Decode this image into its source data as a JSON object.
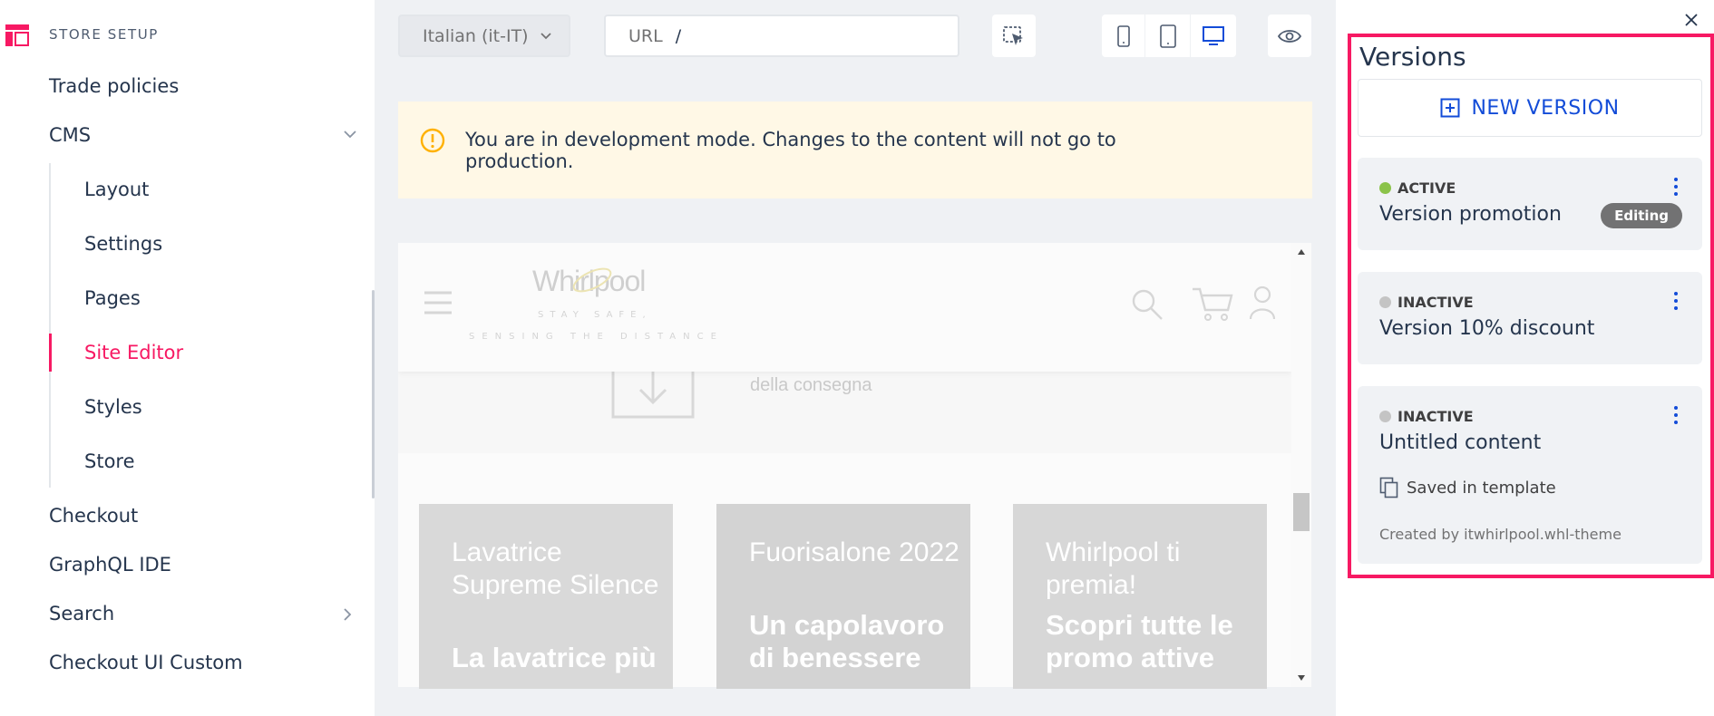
{
  "sidebar": {
    "header": "STORE SETUP",
    "items": [
      {
        "label": "Trade policies"
      },
      {
        "label": "CMS"
      },
      {
        "label": "Checkout"
      },
      {
        "label": "GraphQL IDE"
      },
      {
        "label": "Search"
      },
      {
        "label": "Checkout UI Custom"
      }
    ],
    "cms_children": [
      {
        "label": "Layout"
      },
      {
        "label": "Settings"
      },
      {
        "label": "Pages"
      },
      {
        "label": "Site Editor",
        "active": true
      },
      {
        "label": "Styles"
      },
      {
        "label": "Store"
      }
    ]
  },
  "toolbar": {
    "locale": "Italian (it-IT)",
    "url_label": "URL",
    "url_value": "/"
  },
  "alert": {
    "text": "You are in development mode. Changes to the content will not go to production."
  },
  "preview": {
    "brand": "Whirlpool",
    "tagline_1": "STAY SAFE,",
    "tagline_2": "SENSING THE DISTANCE",
    "delivery_text": "della consegna",
    "cards": [
      {
        "title": "Lavatrice Supreme Silence",
        "subtitle": "La lavatrice più"
      },
      {
        "title": "Fuorisalone 2022",
        "subtitle": "Un capolavoro di benessere"
      },
      {
        "title": "Whirlpool ti premia!",
        "subtitle": "Scopri tutte le promo attive"
      }
    ]
  },
  "versions": {
    "title": "Versions",
    "new_version": "NEW VERSION",
    "list": [
      {
        "status": "ACTIVE",
        "name": "Version promotion",
        "badge": "Editing",
        "status_color": "#8bc34a"
      },
      {
        "status": "INACTIVE",
        "name": "Version 10% discount",
        "status_color": "#c4c4c4"
      },
      {
        "status": "INACTIVE",
        "name": "Untitled content",
        "status_color": "#c4c4c4",
        "saved": "Saved in template",
        "created_by": "Created by itwhirlpool.whl-theme"
      }
    ]
  },
  "colors": {
    "accent": "#f71963",
    "link": "#134cd8",
    "active_dot": "#8bc34a"
  }
}
